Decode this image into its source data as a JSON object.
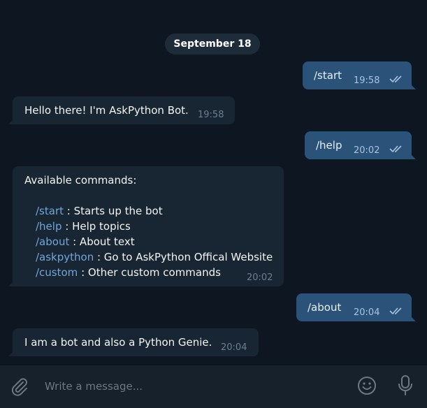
{
  "chat": {
    "date_separator": "September 18",
    "messages": [
      {
        "direction": "out",
        "text": "/start",
        "time": "19:58",
        "read": true
      },
      {
        "direction": "in",
        "text": "Hello there! I'm AskPython Bot.",
        "time": "19:58"
      },
      {
        "direction": "out",
        "text": "/help",
        "time": "20:02",
        "read": true
      },
      {
        "direction": "in",
        "heading": "Available commands:",
        "commands": [
          {
            "cmd": "/start",
            "desc": " : Starts up the bot"
          },
          {
            "cmd": "/help",
            "desc": " : Help topics"
          },
          {
            "cmd": "/about",
            "desc": " : About text"
          },
          {
            "cmd": "/askpython",
            "desc": " : Go to AskPython Offical Website"
          },
          {
            "cmd": "/custom",
            "desc": " : Other custom commands"
          }
        ],
        "time": "20:02"
      },
      {
        "direction": "out",
        "text": "/about",
        "time": "20:04",
        "read": true
      },
      {
        "direction": "in",
        "text": "I am a bot and also a Python Genie.",
        "time": "20:04"
      }
    ]
  },
  "composer": {
    "placeholder": "Write a message...",
    "value": "",
    "attach_icon": "paperclip-icon",
    "emoji_icon": "emoji-icon",
    "voice_icon": "microphone-icon"
  },
  "colors": {
    "background": "#0e1621",
    "outgoing_bubble": "#2b5278",
    "incoming_bubble": "#182533",
    "command_link": "#71a6d9",
    "composer": "#17212b"
  }
}
